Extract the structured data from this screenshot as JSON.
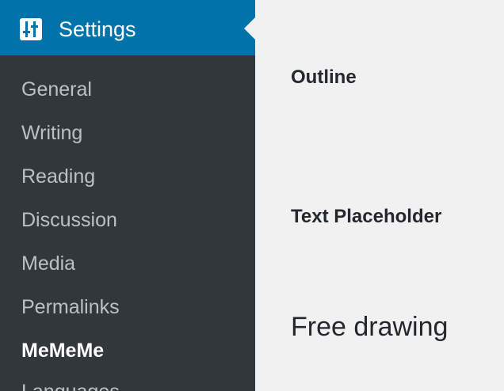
{
  "sidebar": {
    "header": {
      "icon": "settings-sliders-icon",
      "label": "Settings"
    },
    "items": [
      {
        "label": "General"
      },
      {
        "label": "Writing"
      },
      {
        "label": "Reading"
      },
      {
        "label": "Discussion"
      },
      {
        "label": "Media"
      },
      {
        "label": "Permalinks"
      },
      {
        "label": "MeMeMe",
        "current": true
      },
      {
        "label": "Languages"
      }
    ]
  },
  "main": {
    "sections": [
      {
        "title": "Outline"
      },
      {
        "title": "Text Placeholder"
      },
      {
        "title": "Free drawing"
      }
    ]
  },
  "colors": {
    "sidebar_bg": "#32373c",
    "header_bg": "#0073aa",
    "content_bg": "#f1f1f1",
    "heading_text": "#23282d"
  }
}
